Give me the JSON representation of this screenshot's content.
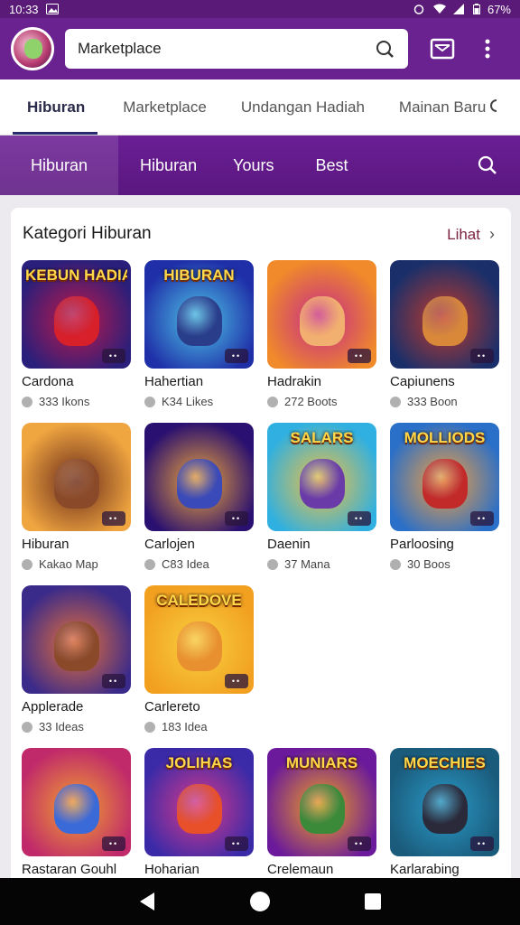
{
  "status_bar": {
    "time": "10:33",
    "battery": "67%"
  },
  "header": {
    "search_value": "Marketplace",
    "icons": {
      "avatar": "user-avatar",
      "search": "search-icon",
      "inbox": "inbox-icon",
      "more": "more-vert-icon"
    }
  },
  "top_tabs": [
    {
      "label": "Hiburan",
      "active": true
    },
    {
      "label": "Marketplace",
      "active": false
    },
    {
      "label": "Undangan Hadiah",
      "active": false
    },
    {
      "label": "Mainan Baru",
      "active": false
    }
  ],
  "sub_nav": [
    {
      "label": "Hiburan",
      "active": true
    },
    {
      "label": "Hiburan",
      "active": false
    },
    {
      "label": "Yours",
      "active": false
    },
    {
      "label": "Best",
      "active": false
    }
  ],
  "section": {
    "title": "Kategori Hiburan",
    "see_all": "Lihat"
  },
  "tiles": [
    {
      "name": "Cardona",
      "meta": "333 Ikons",
      "thumb_title": "KEBUN HADIAH",
      "bg": [
        "#2a1f7a",
        "#c0184a"
      ],
      "figure": "#d8202a"
    },
    {
      "name": "Hahertian",
      "meta": "K34 Likes",
      "thumb_title": "HIBURAN",
      "bg": [
        "#1f2fa8",
        "#4ec6e8"
      ],
      "figure": "#2a3d8a"
    },
    {
      "name": "Hadrakin",
      "meta": "272 Boots",
      "thumb_title": "",
      "bg": [
        "#f08a2a",
        "#c42a8a"
      ],
      "figure": "#f2b070"
    },
    {
      "name": "Capiunens",
      "meta": "333 Boon",
      "thumb_title": "",
      "bg": [
        "#1a2f6a",
        "#c23a2a"
      ],
      "figure": "#d9883a"
    },
    {
      "name": "Hiburan",
      "meta": "Kakao Map",
      "thumb_title": "",
      "bg": [
        "#f0a640",
        "#6a2a1a"
      ],
      "figure": "#8a4a2a"
    },
    {
      "name": "Carlojen",
      "meta": "C83 Idea",
      "thumb_title": "",
      "bg": [
        "#2a1070",
        "#f2a83a"
      ],
      "figure": "#3a4ab8"
    },
    {
      "name": "Daenin",
      "meta": "37 Mana",
      "thumb_title": "SALARS",
      "bg": [
        "#30b0e0",
        "#f2c040"
      ],
      "figure": "#6a3aa8"
    },
    {
      "name": "Parloosing",
      "meta": "30 Boos",
      "thumb_title": "MOLLIODS",
      "bg": [
        "#2a6fc8",
        "#f2a040"
      ],
      "figure": "#c22a2a"
    },
    {
      "name": "Applerade",
      "meta": "33 Ideas",
      "thumb_title": "",
      "bg": [
        "#3a2a8a",
        "#e8703a"
      ],
      "figure": "#8a4a2a"
    },
    {
      "name": "Carlereto",
      "meta": "183 Idea",
      "thumb_title": "CALEDOVE",
      "bg": [
        "#f2a020",
        "#f8d040"
      ],
      "figure": "#e89030"
    },
    {
      "name": "Rastaran Gouhl",
      "meta": "",
      "thumb_title": "",
      "bg": [
        "#c02a6a",
        "#f2a030"
      ],
      "figure": "#3a6ad8"
    },
    {
      "name": "Hoharian",
      "meta": "",
      "thumb_title": "JOLIHAS",
      "bg": [
        "#3a2aa8",
        "#d83a8a"
      ],
      "figure": "#e8502a"
    },
    {
      "name": "Crelemaun",
      "meta": "",
      "thumb_title": "MUNIARS",
      "bg": [
        "#6a1a9a",
        "#f2a020"
      ],
      "figure": "#3a8a3a"
    },
    {
      "name": "Karlarabing",
      "meta": "",
      "thumb_title": "MOECHIES",
      "bg": [
        "#1a5a7a",
        "#2a9ac8"
      ],
      "figure": "#2a2a3a"
    }
  ],
  "bottom_nav": {
    "back": "back-icon",
    "home": "home-icon",
    "recents": "recents-icon"
  }
}
